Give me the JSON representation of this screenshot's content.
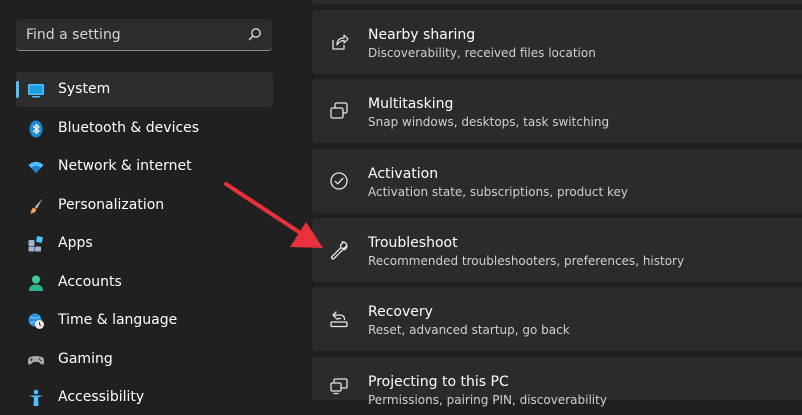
{
  "search": {
    "placeholder": "Find a setting"
  },
  "sidebar": {
    "accent": "#4cc2ff",
    "items": [
      {
        "label": "System",
        "icon": "monitor-icon",
        "selected": true
      },
      {
        "label": "Bluetooth & devices",
        "icon": "bluetooth-icon"
      },
      {
        "label": "Network & internet",
        "icon": "wifi-icon"
      },
      {
        "label": "Personalization",
        "icon": "paintbrush-icon"
      },
      {
        "label": "Apps",
        "icon": "apps-icon"
      },
      {
        "label": "Accounts",
        "icon": "person-icon"
      },
      {
        "label": "Time & language",
        "icon": "globe-clock-icon"
      },
      {
        "label": "Gaming",
        "icon": "gamepad-icon"
      },
      {
        "label": "Accessibility",
        "icon": "accessibility-icon"
      }
    ]
  },
  "settings": [
    {
      "title": "Nearby sharing",
      "subtitle": "Discoverability, received files location",
      "icon": "share-icon"
    },
    {
      "title": "Multitasking",
      "subtitle": "Snap windows, desktops, task switching",
      "icon": "multitasking-icon"
    },
    {
      "title": "Activation",
      "subtitle": "Activation state, subscriptions, product key",
      "icon": "checkmark-circle-icon"
    },
    {
      "title": "Troubleshoot",
      "subtitle": "Recommended troubleshooters, preferences, history",
      "icon": "wrench-icon"
    },
    {
      "title": "Recovery",
      "subtitle": "Reset, advanced startup, go back",
      "icon": "recovery-icon"
    },
    {
      "title": "Projecting to this PC",
      "subtitle": "Permissions, pairing PIN, discoverability",
      "icon": "projecting-icon"
    }
  ],
  "annotation": {
    "color": "#e8313a",
    "icon": "red-arrow"
  }
}
